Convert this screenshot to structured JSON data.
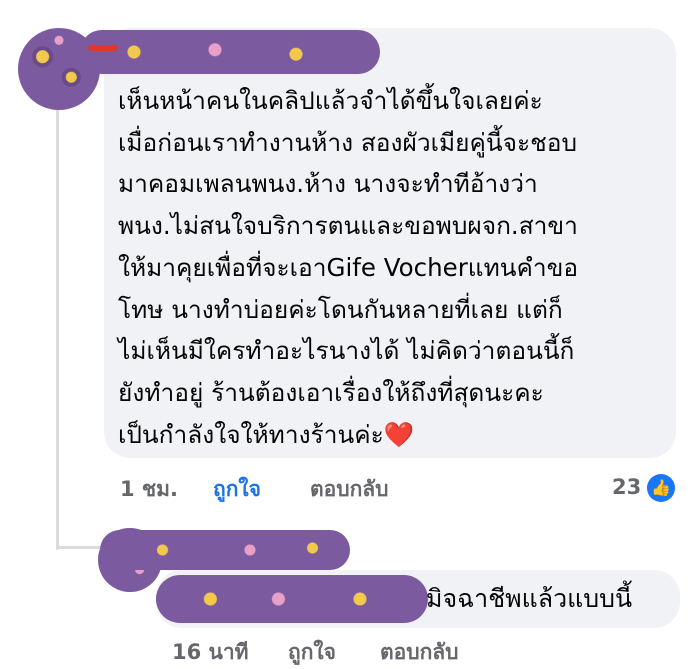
{
  "comment": {
    "lines": [
      "เห็นหน้าคนในคลิปแล้วจำได้ขึ้นใจเลยค่ะ",
      "เมื่อก่อนเราทำงานห้าง สองผัวเมียคู่นี้จะชอบ",
      "มาคอมเพลนพนง.ห้าง นางจะทำทีอ้างว่า",
      "พนง.ไม่สนใจบริการตนและขอพบผจก.สาขา",
      "ให้มาคุยเพื่อที่จะเอาGife Vocherแทนคำขอ",
      "โทษ นางทำบ่อยค่ะโดนกันหลายที่เลย แต่ก็",
      "ไม่เห็นมีใครทำอะไรนางได้ ไม่คิดว่าตอนนี้ก็",
      "ยังทำอยู่ ร้านต้องเอาเรื่องให้ถึงที่สุดนะคะ",
      "เป็นกำลังใจให้ทางร้านค่ะ"
    ],
    "heart_emoji": "❤️",
    "time": "1 ชม.",
    "like_label": "ถูกใจ",
    "reply_label": "ตอบกลับ",
    "reaction_count": "23",
    "reaction_icon": "thumbs-up-icon"
  },
  "reply": {
    "text": "มิจฉาชีพแล้วแบบนี้",
    "time": "16 นาที",
    "like_label": "ถูกใจ",
    "reply_label": "ตอบกลับ"
  },
  "colors": {
    "bubble_bg": "#f0f2f5",
    "meta_gray": "#65676b",
    "like_blue": "#1b74e4",
    "redaction_purple": "#7b5aa0"
  }
}
